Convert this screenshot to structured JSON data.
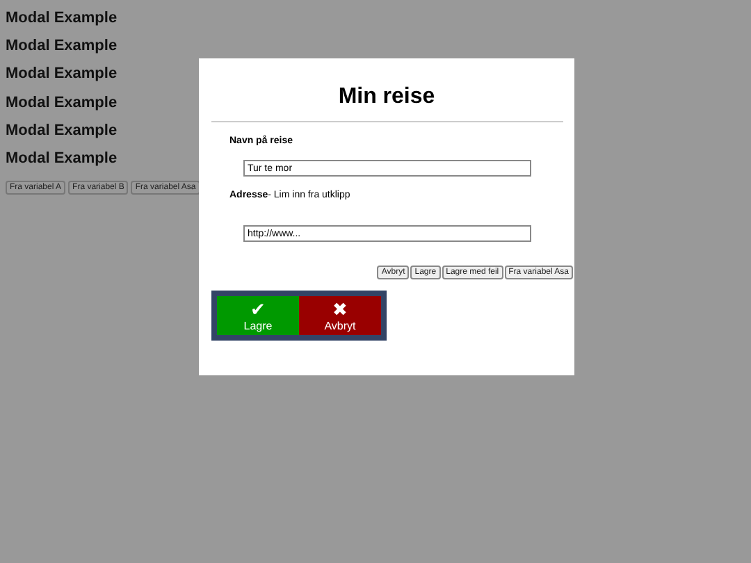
{
  "background": {
    "headings": [
      "Modal Example",
      "Modal Example",
      "Modal Example",
      "Modal Example",
      "Modal Example",
      "Modal Example"
    ],
    "buttons": [
      "Fra variabel A",
      "Fra variabel B",
      "Fra variabel Asa"
    ]
  },
  "modal": {
    "title": "Min reise",
    "name_label": "Navn på reise",
    "name_value": "Tur te mor",
    "address_label": "**Adresse**- Lim inn fra utklipp",
    "address_value": "http://www...",
    "small_buttons": [
      "Avbryt",
      "Lagre",
      "Lagre med feil",
      "Fra variabel Asa"
    ],
    "big_buttons": [
      {
        "kind": "save",
        "icon": "✔",
        "label": "Lagre"
      },
      {
        "kind": "cancel",
        "icon": "✖",
        "label": "Avbryt"
      }
    ]
  }
}
